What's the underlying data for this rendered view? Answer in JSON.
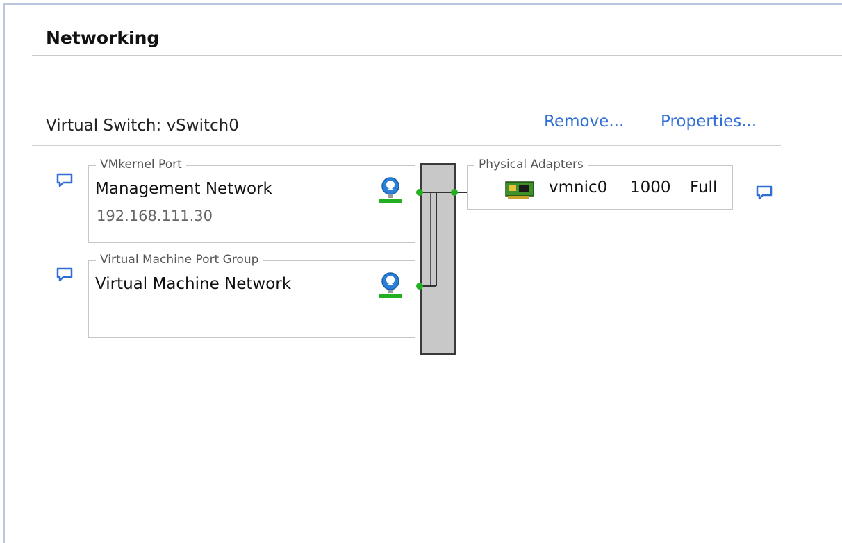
{
  "panel": {
    "title": "Networking"
  },
  "vswitch": {
    "title": "Virtual Switch: vSwitch0",
    "remove_label": "Remove...",
    "properties_label": "Properties..."
  },
  "vmkernel": {
    "legend": "VMkernel Port",
    "name": "Management Network",
    "ip": "192.168.111.30"
  },
  "vm_group": {
    "legend": "Virtual Machine Port Group",
    "name": "Virtual Machine Network"
  },
  "physical": {
    "legend": "Physical Adapters",
    "nic": "vmnic0",
    "speed": "1000",
    "duplex": "Full"
  },
  "colors": {
    "link": "#2f6fd6",
    "connector_green": "#22b022",
    "globe_blue": "#2a7fd8",
    "switch_fill": "#c8c8c8"
  },
  "icons": [
    "note-icon",
    "globe-network-icon",
    "nic-card-icon"
  ]
}
